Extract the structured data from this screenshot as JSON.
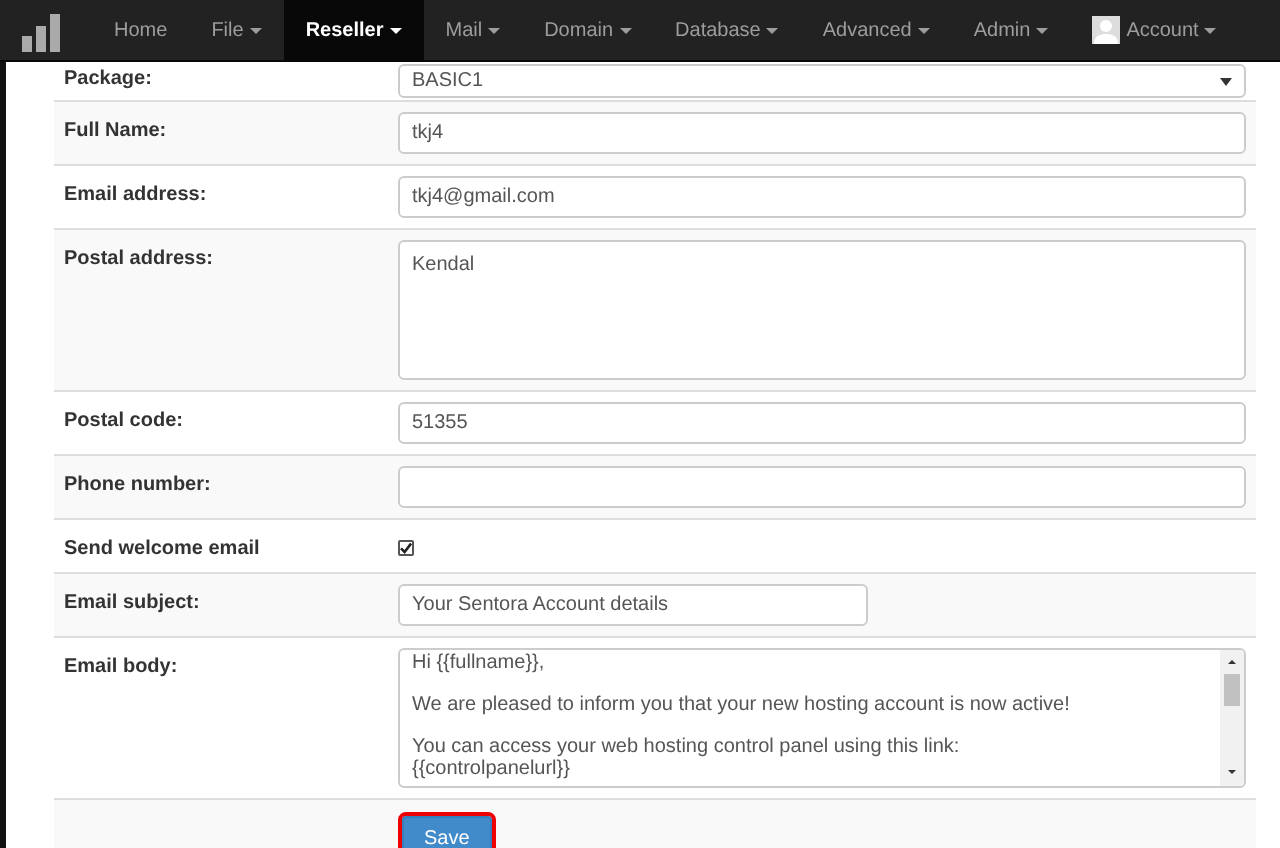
{
  "nav": {
    "items": [
      {
        "label": "Home",
        "selected": false,
        "dropdown": false,
        "avatar": false
      },
      {
        "label": "File",
        "selected": false,
        "dropdown": true,
        "avatar": false
      },
      {
        "label": "Reseller",
        "selected": true,
        "dropdown": true,
        "avatar": false
      },
      {
        "label": "Mail",
        "selected": false,
        "dropdown": true,
        "avatar": false
      },
      {
        "label": "Domain",
        "selected": false,
        "dropdown": true,
        "avatar": false
      },
      {
        "label": "Database",
        "selected": false,
        "dropdown": true,
        "avatar": false
      },
      {
        "label": "Advanced",
        "selected": false,
        "dropdown": true,
        "avatar": false
      },
      {
        "label": "Admin",
        "selected": false,
        "dropdown": true,
        "avatar": false
      },
      {
        "label": "Account",
        "selected": false,
        "dropdown": true,
        "avatar": true
      }
    ]
  },
  "form": {
    "rows": [
      {
        "kind": "select",
        "label": "Package:",
        "value": "BASIC1"
      },
      {
        "kind": "text",
        "label": "Full Name:",
        "value": "tkj4"
      },
      {
        "kind": "text",
        "label": "Email address:",
        "value": "tkj4@gmail.com"
      },
      {
        "kind": "textarea",
        "label": "Postal address:",
        "value": "Kendal"
      },
      {
        "kind": "text",
        "label": "Postal code:",
        "value": "51355"
      },
      {
        "kind": "text",
        "label": "Phone number:",
        "value": ""
      },
      {
        "kind": "checkbox",
        "label": "Send welcome email",
        "checked": true
      },
      {
        "kind": "short",
        "label": "Email subject:",
        "value": "Your Sentora Account details"
      },
      {
        "kind": "body",
        "label": "Email body:",
        "paragraphs": [
          [
            "Hi {{fullname}},"
          ],
          [
            "We are pleased to inform you that your new hosting account is now active!"
          ],
          [
            "You can access your web hosting control panel using this link:",
            "{{controlpanelurl}}"
          ]
        ]
      }
    ],
    "save_button": "Save"
  }
}
